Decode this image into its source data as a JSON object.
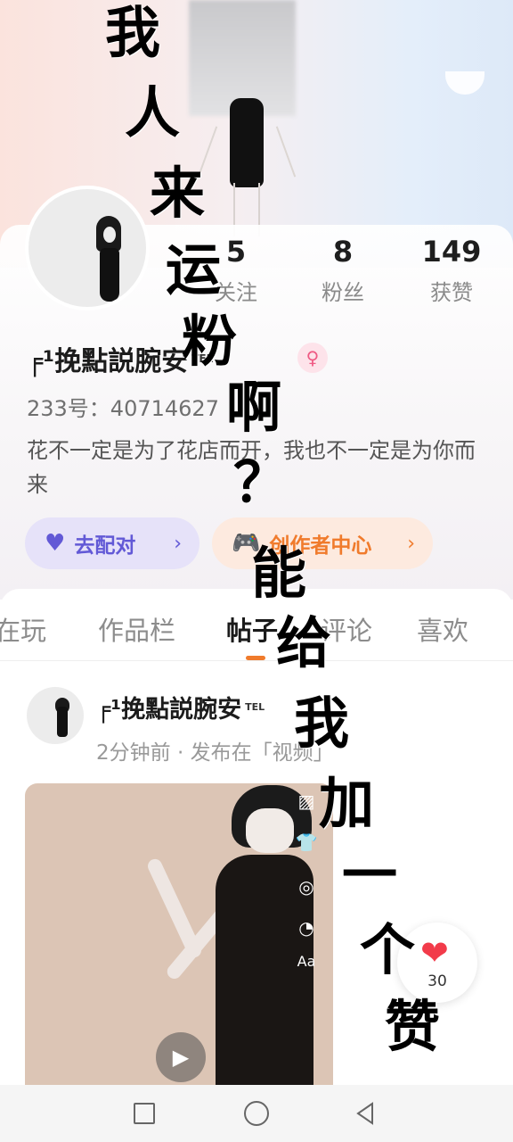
{
  "profile": {
    "stats": [
      {
        "value": "5",
        "label": "关注"
      },
      {
        "value": "8",
        "label": "粉丝"
      },
      {
        "value": "149",
        "label": "获赞"
      }
    ],
    "nickname": "╒¹挽點説腕安",
    "nickname_suffix": "TEL",
    "gender_icon": "♀",
    "uid": "233号：40714627",
    "bio": "花不一定是为了花店而开，我也不一定是为你而来"
  },
  "buttons": {
    "match": {
      "label": "去配对",
      "icon": "heart-icon",
      "chevron": "›"
    },
    "creator": {
      "label": "创作者中心",
      "icon": "gamepad-icon",
      "chevron": "›"
    }
  },
  "tabs": [
    {
      "label": "在玩"
    },
    {
      "label": "作品栏"
    },
    {
      "label": "帖子",
      "active": true
    },
    {
      "label": "评论"
    },
    {
      "label": "喜欢"
    }
  ],
  "post": {
    "author": "╒¹挽點説腕安",
    "author_suffix": "TEL",
    "meta": "2分钟前 · 发布在「视频」",
    "tools": [
      "▨",
      "👕",
      "◎",
      "◔",
      "Aa"
    ],
    "play_icon": "▶",
    "likes": "30"
  },
  "overlay_text": [
    "我",
    "人",
    "来",
    "运",
    "粉",
    "啊",
    "？",
    "能",
    "给",
    "我",
    "加",
    "一",
    "个",
    "赞"
  ],
  "colors": {
    "accent_orange": "#f07b2c",
    "accent_purple": "#6259d6",
    "like_red": "#f23b4a"
  }
}
